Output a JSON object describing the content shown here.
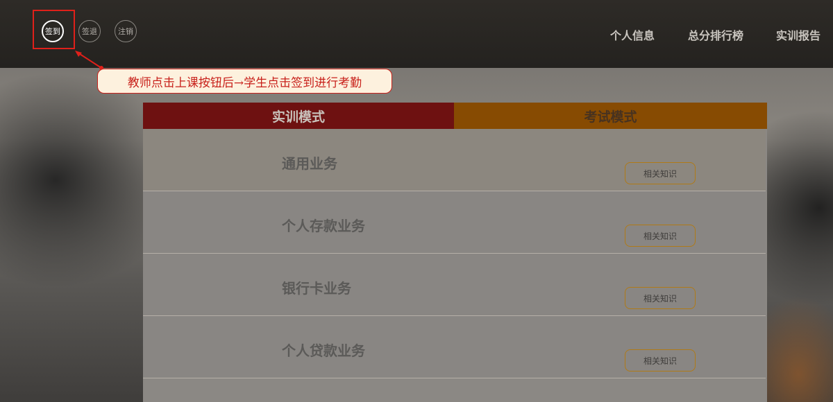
{
  "header": {
    "actions": [
      {
        "label": "签到",
        "active": true
      },
      {
        "label": "签退",
        "active": false
      },
      {
        "label": "注销",
        "active": false
      }
    ],
    "nav": [
      {
        "label": "个人信息"
      },
      {
        "label": "总分排行榜"
      },
      {
        "label": "实训报告"
      }
    ]
  },
  "annotation": {
    "text": "教师点击上课按钮后→学生点击签到进行考勤",
    "color": "#c8201a"
  },
  "panel": {
    "tabs": [
      {
        "label": "实训模式"
      },
      {
        "label": "考试模式"
      }
    ],
    "rows": [
      {
        "title": "通用业务",
        "button": "相关知识"
      },
      {
        "title": "个人存款业务",
        "button": "相关知识"
      },
      {
        "title": "银行卡业务",
        "button": "相关知识"
      },
      {
        "title": "个人贷款业务",
        "button": "相关知识"
      }
    ]
  }
}
